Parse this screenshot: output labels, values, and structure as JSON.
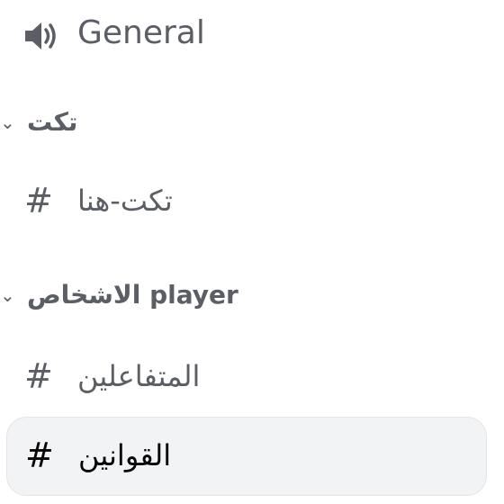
{
  "voice_channel": {
    "icon": "speaker-icon",
    "label": "General"
  },
  "categories": [
    {
      "label": "تكت",
      "collapse_icon": "chevron-down-icon",
      "channels": [
        {
          "label": "تكت-هنا",
          "icon": "hash-icon"
        }
      ]
    },
    {
      "label": "الاشخاص player",
      "collapse_icon": "chevron-down-icon",
      "channels": [
        {
          "label": "المتفاعلين",
          "icon": "hash-icon"
        },
        {
          "label": "القوانين",
          "icon": "hash-icon",
          "selected": true
        }
      ]
    }
  ],
  "colors": {
    "text_muted": "#5c5e66",
    "text_active": "#060607",
    "active_bg": "#f2f3f5"
  }
}
